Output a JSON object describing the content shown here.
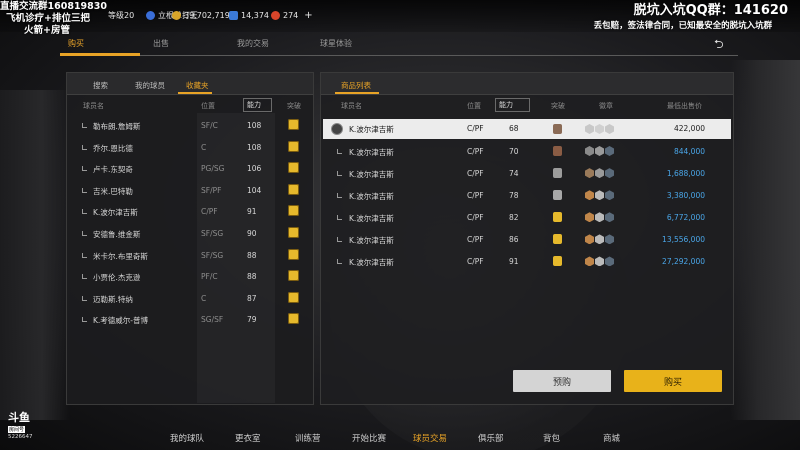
{
  "stream_overlay": {
    "left_lines": [
      "直播交流群160819830",
      "飞机诊疗+排位三把",
      "火箭+房管"
    ],
    "right_title": "脱坑入坑QQ群：141620",
    "right_sub": "丢包赔，签法律合同，已知最安全的脱坑入坑群"
  },
  "status_bar": {
    "level_label": "等级20",
    "title_label": "立根单打王",
    "coins": "39,702,719",
    "gems": "14,374",
    "tickets": "274",
    "plus": "+"
  },
  "main_tabs": {
    "items": [
      "购买",
      "出售",
      "我的交易",
      "球星体验"
    ],
    "active": 0
  },
  "left_panel": {
    "tabs": [
      "搜索",
      "我的球员",
      "收藏夹"
    ],
    "active_tab": 2,
    "headers": {
      "name": "球员名",
      "position": "位置",
      "ability": "能力",
      "breakthrough": "突破"
    },
    "rows": [
      {
        "name": "勒布朗.詹姆斯",
        "position": "SF/C",
        "ability": "108"
      },
      {
        "name": "乔尔.恩比德",
        "position": "C",
        "ability": "108"
      },
      {
        "name": "卢卡.东契奇",
        "position": "PG/SG",
        "ability": "106"
      },
      {
        "name": "吉米.巴特勒",
        "position": "SF/PF",
        "ability": "104"
      },
      {
        "name": "K.波尔津吉斯",
        "position": "C/PF",
        "ability": "91"
      },
      {
        "name": "安德鲁.维金斯",
        "position": "SF/SG",
        "ability": "90"
      },
      {
        "name": "米卡尔.布里奇斯",
        "position": "SF/SG",
        "ability": "88"
      },
      {
        "name": "小贾伦.杰克逊",
        "position": "PF/C",
        "ability": "88"
      },
      {
        "name": "迈勒斯.特纳",
        "position": "C",
        "ability": "87"
      },
      {
        "name": "K.考德威尔-普博",
        "position": "SG/SF",
        "ability": "79"
      }
    ]
  },
  "right_panel": {
    "tab": "商品列表",
    "headers": {
      "name": "球员名",
      "position": "位置",
      "ability": "能力",
      "breakthrough": "突破",
      "medals": "徽章",
      "lowest_price": "最低出售价"
    },
    "rows": [
      {
        "name": "K.波尔津吉斯",
        "position": "C/PF",
        "ability": "68",
        "price": "422,000",
        "selected": true,
        "bk_color": "#8a6a55"
      },
      {
        "name": "K.波尔津吉斯",
        "position": "C/PF",
        "ability": "70",
        "price": "844,000",
        "selected": false,
        "bk_color": "#8a5c44"
      },
      {
        "name": "K.波尔津吉斯",
        "position": "C/PF",
        "ability": "74",
        "price": "1,688,000",
        "selected": false,
        "bk_color": "#9c9c9c"
      },
      {
        "name": "K.波尔津吉斯",
        "position": "C/PF",
        "ability": "78",
        "price": "3,380,000",
        "selected": false,
        "bk_color": "#a8a8a8"
      },
      {
        "name": "K.波尔津吉斯",
        "position": "C/PF",
        "ability": "82",
        "price": "6,772,000",
        "selected": false,
        "bk_color": "#e6b92c"
      },
      {
        "name": "K.波尔津吉斯",
        "position": "C/PF",
        "ability": "86",
        "price": "13,556,000",
        "selected": false,
        "bk_color": "#e6b92c"
      },
      {
        "name": "K.波尔津吉斯",
        "position": "C/PF",
        "ability": "91",
        "price": "27,292,000",
        "selected": false,
        "bk_color": "#e6b92c"
      }
    ]
  },
  "buttons": {
    "preorder": "预购",
    "buy": "购买"
  },
  "bottom_nav": {
    "items": [
      "我的球队",
      "更衣室",
      "训练营",
      "开始比赛",
      "球员交易",
      "俱乐部",
      "背包",
      "商城"
    ],
    "active": 4
  },
  "logo": {
    "text": "斗鱼",
    "sub": "房间号",
    "room_id": "5226647"
  },
  "colors": {
    "accent": "#e8a326",
    "price_blue": "#4aa6e8",
    "buy_button": "#e8b21a"
  }
}
